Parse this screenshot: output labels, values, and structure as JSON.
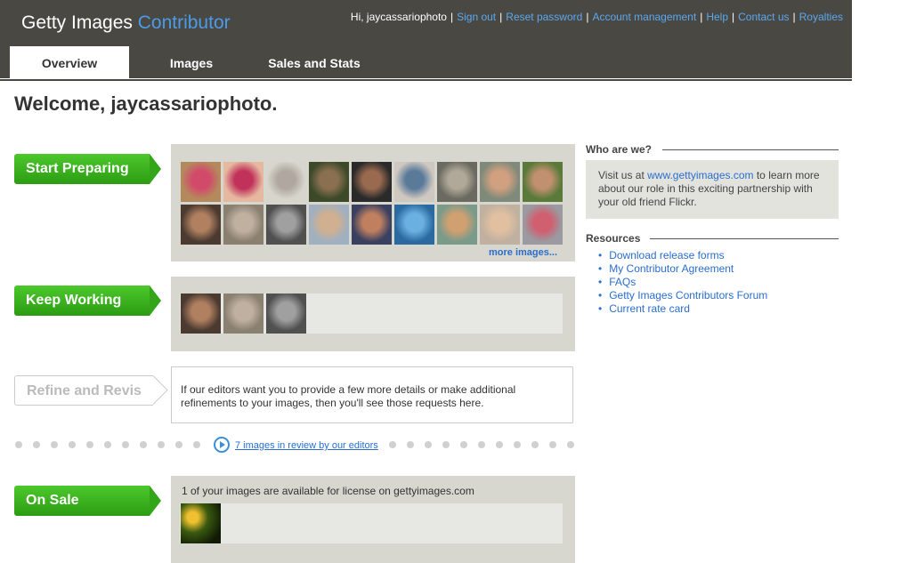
{
  "header": {
    "logo_main": "Getty Images",
    "logo_accent": "Contributor",
    "greeting": "Hi, jaycassariophoto",
    "links": [
      "Sign out",
      "Reset password",
      "Account management",
      "Help",
      "Contact us",
      "Royalties"
    ],
    "tabs": [
      "Overview",
      "Images",
      "Sales and Stats"
    ],
    "active_tab": "Overview"
  },
  "welcome": "Welcome, jaycassariophoto.",
  "stages": {
    "start_preparing": {
      "label": "Start Preparing",
      "more_link": "more images...",
      "thumb_count": 18
    },
    "keep_working": {
      "label": "Keep Working",
      "thumb_count": 3
    },
    "refine_revise": {
      "label": "Refine and Revise",
      "text": "If our editors want you to provide a few more details or make additional refinements to your images, then you'll see those requests here."
    },
    "review_link": "7 images in review by our editors",
    "on_sale": {
      "label": "On Sale",
      "text": "1 of your images are available for license on gettyimages.com",
      "thumb_count": 1
    }
  },
  "sidebar": {
    "who_heading": "Who are we?",
    "who_prefix": "Visit us at ",
    "who_link": "www.gettyimages.com",
    "who_suffix": " to learn more about our role in this exciting partnership with your old friend Flickr.",
    "resources_heading": "Resources",
    "resources": [
      "Download release forms",
      "My Contributor Agreement",
      "FAQs",
      "Getty Images Contributors Forum",
      "Current rate card"
    ]
  },
  "colors": {
    "header_bg": "#4a4843",
    "accent_blue": "#4a9be8",
    "stage_green": "#2c9c13",
    "panel_gray": "#d7d6cf"
  }
}
